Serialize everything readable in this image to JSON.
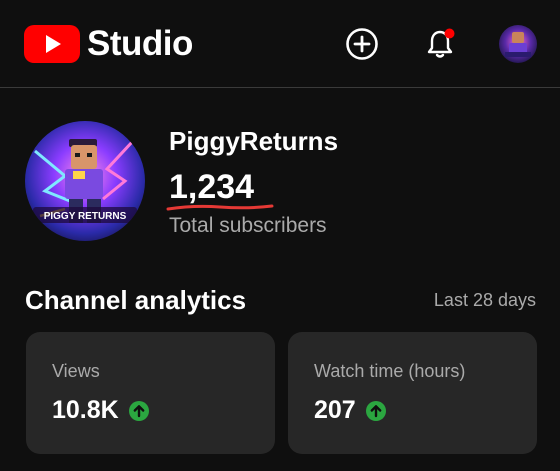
{
  "header": {
    "app_name": "Studio",
    "icons": [
      "youtube-logo-icon",
      "create-icon",
      "notifications-icon",
      "account-avatar"
    ],
    "brand_color": "#ff0000",
    "notification_dot_color": "#ff0000"
  },
  "channel": {
    "name": "PiggyReturns",
    "avatar_caption": "PIGGY RETURNS",
    "subscribers": "1,234",
    "subscribers_label": "Total subscribers",
    "underline_color": "#e53935"
  },
  "analytics": {
    "title": "Channel analytics",
    "period": "Last 28 days",
    "cards": [
      {
        "label": "Views",
        "value": "10.8K",
        "trend": "up",
        "trend_icon": "arrow-up-circle-icon"
      },
      {
        "label": "Watch time (hours)",
        "value": "207",
        "trend": "up",
        "trend_icon": "arrow-up-circle-icon"
      }
    ],
    "trend_color": "#2ba640"
  }
}
